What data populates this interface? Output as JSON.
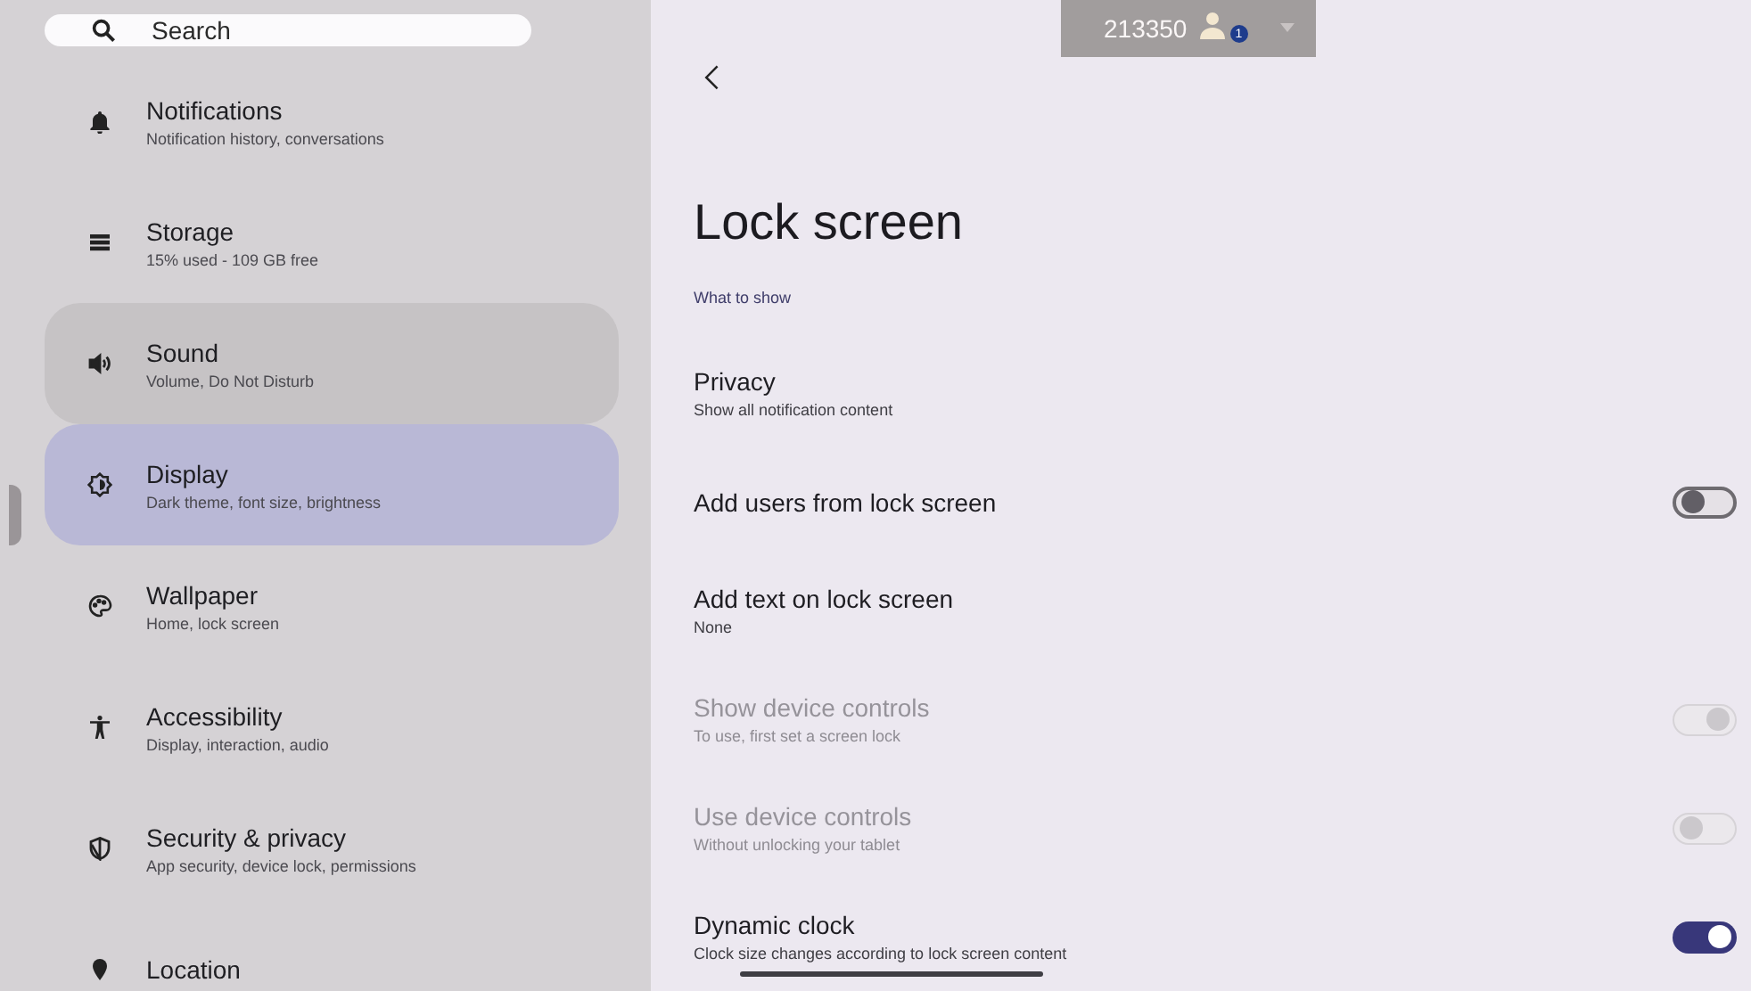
{
  "sidebar": {
    "search": {
      "placeholder": "Search"
    },
    "items": [
      {
        "title": "Notifications",
        "subtitle": "Notification history, conversations",
        "selected": false,
        "hovered": false
      },
      {
        "title": "Storage",
        "subtitle": "15% used - 109 GB free",
        "selected": false,
        "hovered": false
      },
      {
        "title": "Sound",
        "subtitle": "Volume, Do Not Disturb",
        "selected": false,
        "hovered": true
      },
      {
        "title": "Display",
        "subtitle": "Dark theme, font size, brightness",
        "selected": true,
        "hovered": false
      },
      {
        "title": "Wallpaper",
        "subtitle": "Home, lock screen",
        "selected": false,
        "hovered": false
      },
      {
        "title": "Accessibility",
        "subtitle": "Display, interaction, audio",
        "selected": false,
        "hovered": false
      },
      {
        "title": "Security & privacy",
        "subtitle": "App security, device lock, permissions",
        "selected": false,
        "hovered": false
      },
      {
        "title": "Location",
        "selected": false,
        "hovered": false
      }
    ]
  },
  "banner": {
    "text": "213350",
    "badge": "1"
  },
  "page": {
    "title": "Lock screen",
    "section": "What to show",
    "rows": [
      {
        "kind": "text",
        "title": "Privacy",
        "subtitle": "Show all notification content",
        "disabled": false
      },
      {
        "kind": "switch",
        "title": "Add users from lock screen",
        "on": false,
        "disabled": false
      },
      {
        "kind": "text",
        "title": "Add text on lock screen",
        "subtitle": "None",
        "disabled": false
      },
      {
        "kind": "switch",
        "title": "Show device controls",
        "subtitle": "To use, first set a screen lock",
        "on": true,
        "disabled": true
      },
      {
        "kind": "switch",
        "title": "Use device controls",
        "subtitle": "Without unlocking your tablet",
        "on": false,
        "disabled": true
      },
      {
        "kind": "switch",
        "title": "Dynamic clock",
        "subtitle": "Clock size changes according to lock screen content",
        "on": true,
        "disabled": false
      }
    ]
  }
}
